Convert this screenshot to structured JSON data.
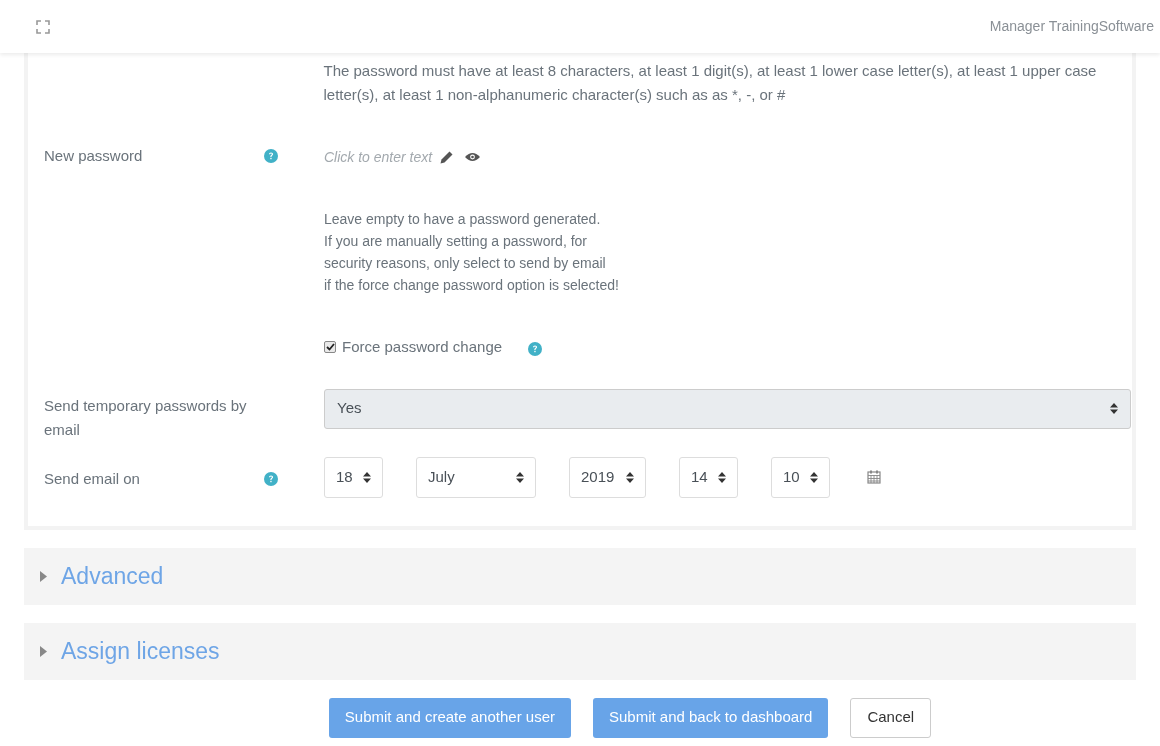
{
  "header": {
    "title": "Manager TrainingSoftware"
  },
  "password_policy": "The password must have at least 8 characters, at least 1 digit(s), at least 1 lower case letter(s), at least 1 upper case letter(s), at least 1 non-alphanumeric character(s) such as as *, -, or #",
  "new_password": {
    "label": "New password",
    "placeholder": "Click to enter text"
  },
  "password_help": [
    "Leave empty to have a password generated.",
    "If you are manually setting a password, for",
    "security reasons, only select to send by email",
    "if the force change password option is selected!"
  ],
  "force_change": {
    "label": "Force password change",
    "checked": true
  },
  "send_temp": {
    "label": "Send temporary passwords by email",
    "value": "Yes"
  },
  "send_on": {
    "label": "Send email on",
    "selects": [
      {
        "value": "18"
      },
      {
        "value": "July"
      },
      {
        "value": "2019"
      },
      {
        "value": "14"
      },
      {
        "value": "10"
      }
    ]
  },
  "sections": [
    {
      "title": "Advanced",
      "expanded": false
    },
    {
      "title": "Assign licenses",
      "expanded": false
    }
  ],
  "buttons": [
    {
      "label": "Submit and create another user",
      "kind": "primary"
    },
    {
      "label": "Submit and back to dashboard",
      "kind": "primary"
    },
    {
      "label": "Cancel",
      "kind": "secondary"
    }
  ]
}
